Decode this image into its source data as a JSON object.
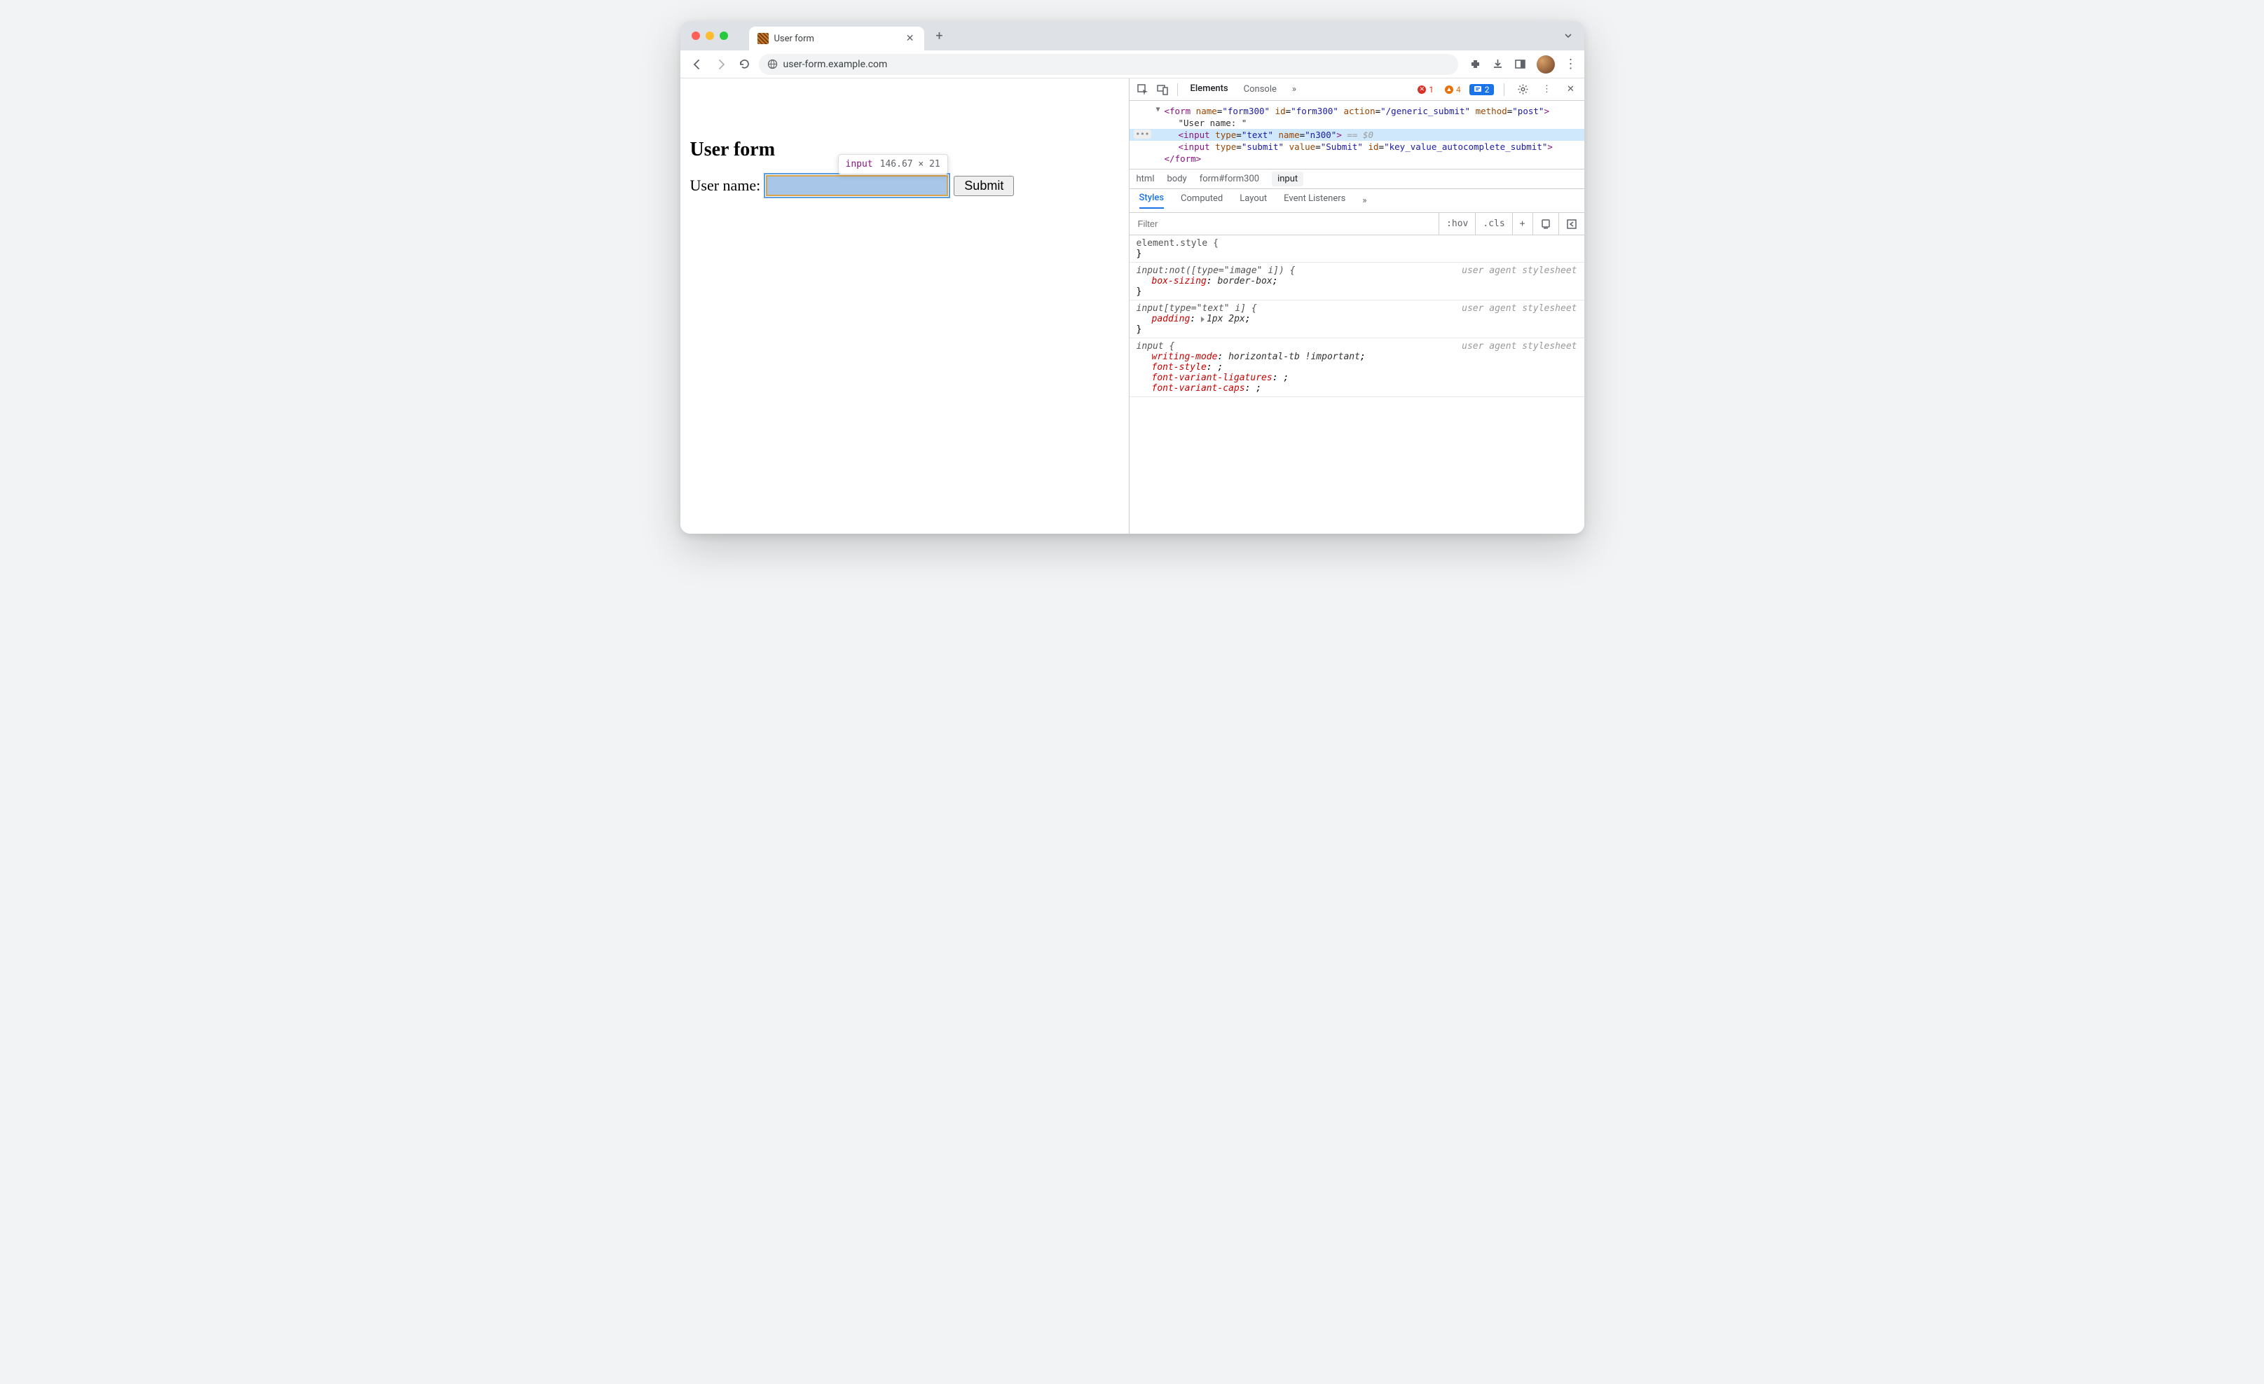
{
  "browser": {
    "tab_title": "User form",
    "url": "user-form.example.com"
  },
  "page": {
    "heading": "User form",
    "label": "User name:",
    "submit_label": "Submit"
  },
  "inspect_tooltip": {
    "tag": "input",
    "dims": "146.67 × 21"
  },
  "devtools": {
    "tabs": {
      "elements": "Elements",
      "console": "Console"
    },
    "counts": {
      "errors": "1",
      "warnings": "4",
      "info": "2"
    },
    "dom": {
      "form_open": "<form name=\"form300\" id=\"form300\" action=\"/generic_submit\" method=\"post\">",
      "text_node": "\"User name: \"",
      "input_text": "<input type=\"text\" name=\"n300\">",
      "input_sel_suffix": " == $0",
      "input_submit": "<input type=\"submit\" value=\"Submit\" id=\"key_value_autocomplete_submit\">",
      "form_close": "</form>"
    },
    "breadcrumb": [
      "html",
      "body",
      "form#form300",
      "input"
    ],
    "styles_tabs": {
      "styles": "Styles",
      "computed": "Computed",
      "layout": "Layout",
      "event": "Event Listeners"
    },
    "filter_placeholder": "Filter",
    "filter_actions": {
      "hov": ":hov",
      "cls": ".cls",
      "plus": "+"
    },
    "rules": {
      "r0_sel": "element.style {",
      "r0_close": "}",
      "r1_sel": "input:not([type=\"image\" i]) {",
      "r1_origin": "user agent stylesheet",
      "r1_prop": "box-sizing",
      "r1_val": "border-box",
      "r1_close": "}",
      "r2_sel": "input[type=\"text\" i] {",
      "r2_origin": "user agent stylesheet",
      "r2_prop": "padding",
      "r2_val": "1px 2px",
      "r2_close": "}",
      "r3_sel": "input {",
      "r3_origin": "user agent stylesheet",
      "r3_p1": "writing-mode",
      "r3_v1": "horizontal-tb !important",
      "r3_p2": "font-style",
      "r3_v2": "",
      "r3_p3": "font-variant-ligatures",
      "r3_v3": "",
      "r3_p4": "font-variant-caps",
      "r3_v4": ""
    }
  }
}
